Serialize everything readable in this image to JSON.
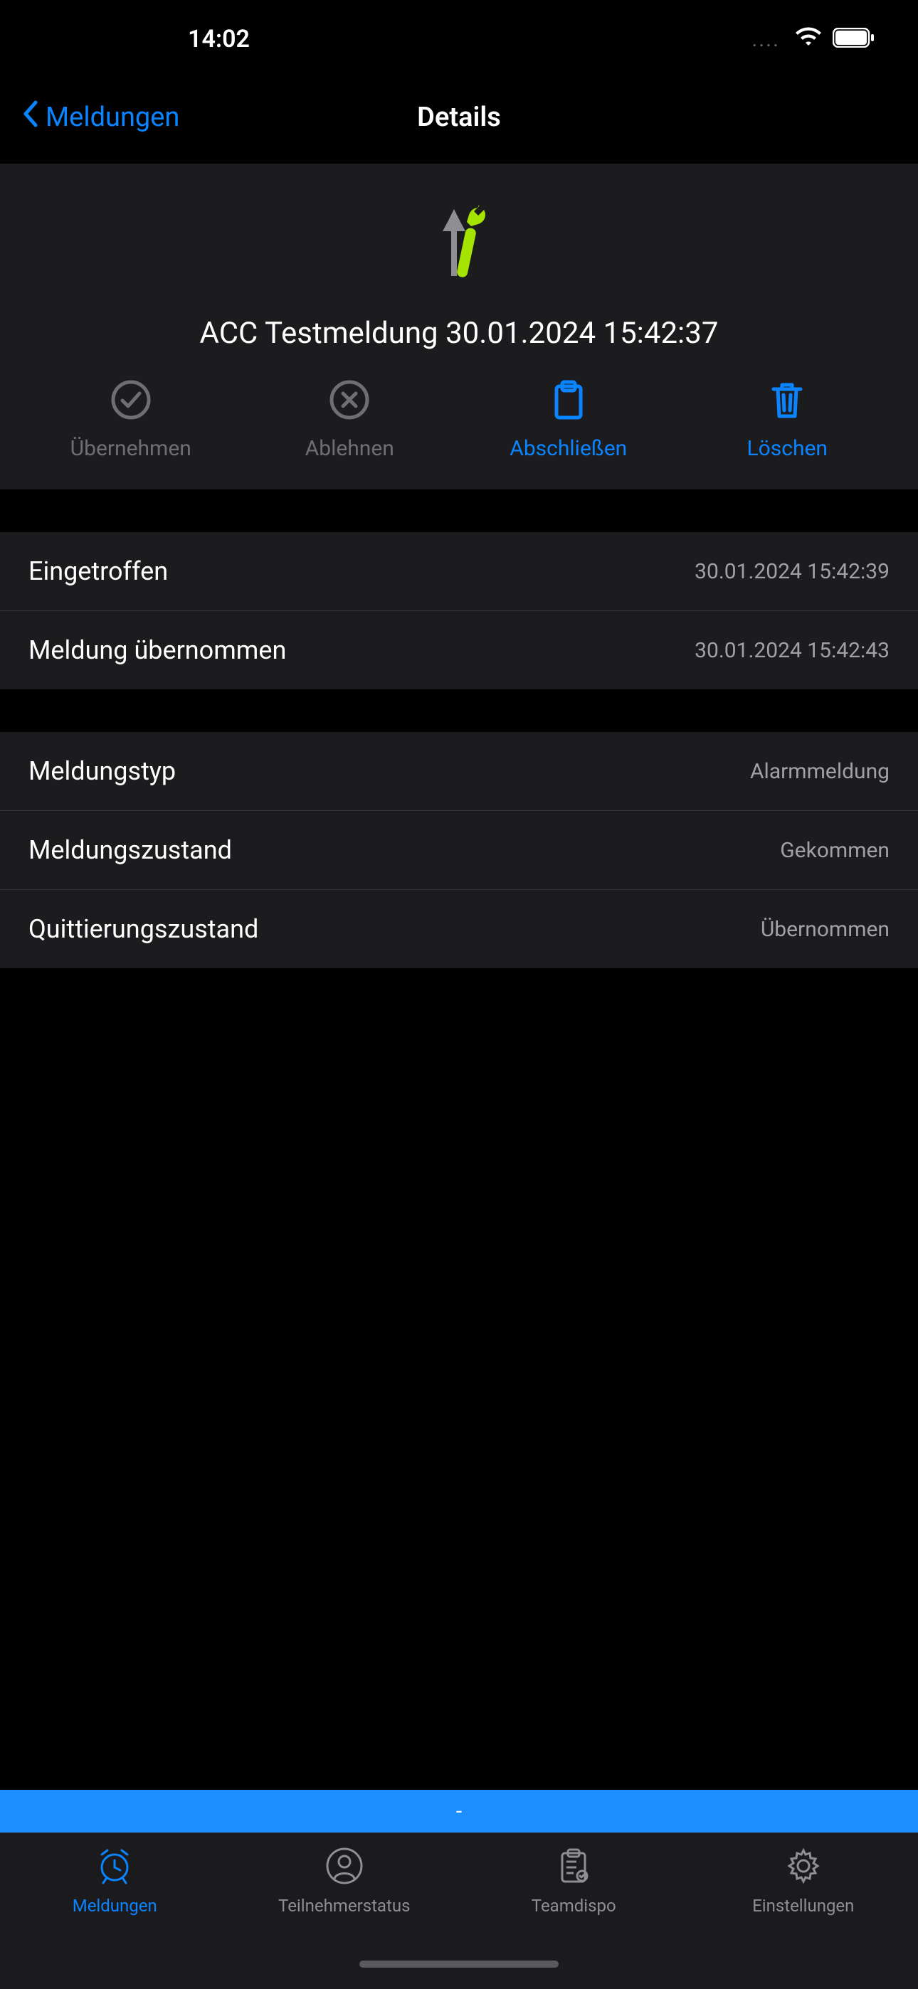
{
  "status_bar": {
    "time": "14:02"
  },
  "nav": {
    "back_label": "Meldungen",
    "title": "Details"
  },
  "detail": {
    "title": "ACC Testmeldung 30.01.2024 15:42:37",
    "actions": {
      "uebernehmen": "Übernehmen",
      "ablehnen": "Ablehnen",
      "abschliessen": "Abschließen",
      "loeschen": "Löschen"
    }
  },
  "timestamps": {
    "eingetroffen_label": "Eingetroffen",
    "eingetroffen_value": "30.01.2024 15:42:39",
    "uebernommen_label": "Meldung übernommen",
    "uebernommen_value": "30.01.2024 15:42:43"
  },
  "info": {
    "meldungstyp_label": "Meldungstyp",
    "meldungstyp_value": "Alarmmeldung",
    "meldungszustand_label": "Meldungszustand",
    "meldungszustand_value": "Gekommen",
    "quittierungszustand_label": "Quittierungszustand",
    "quittierungszustand_value": "Übernommen"
  },
  "status_strip": {
    "text": "-"
  },
  "tabs": {
    "meldungen": "Meldungen",
    "teilnehmerstatus": "Teilnehmerstatus",
    "teamdispo": "Teamdispo",
    "einstellungen": "Einstellungen"
  }
}
